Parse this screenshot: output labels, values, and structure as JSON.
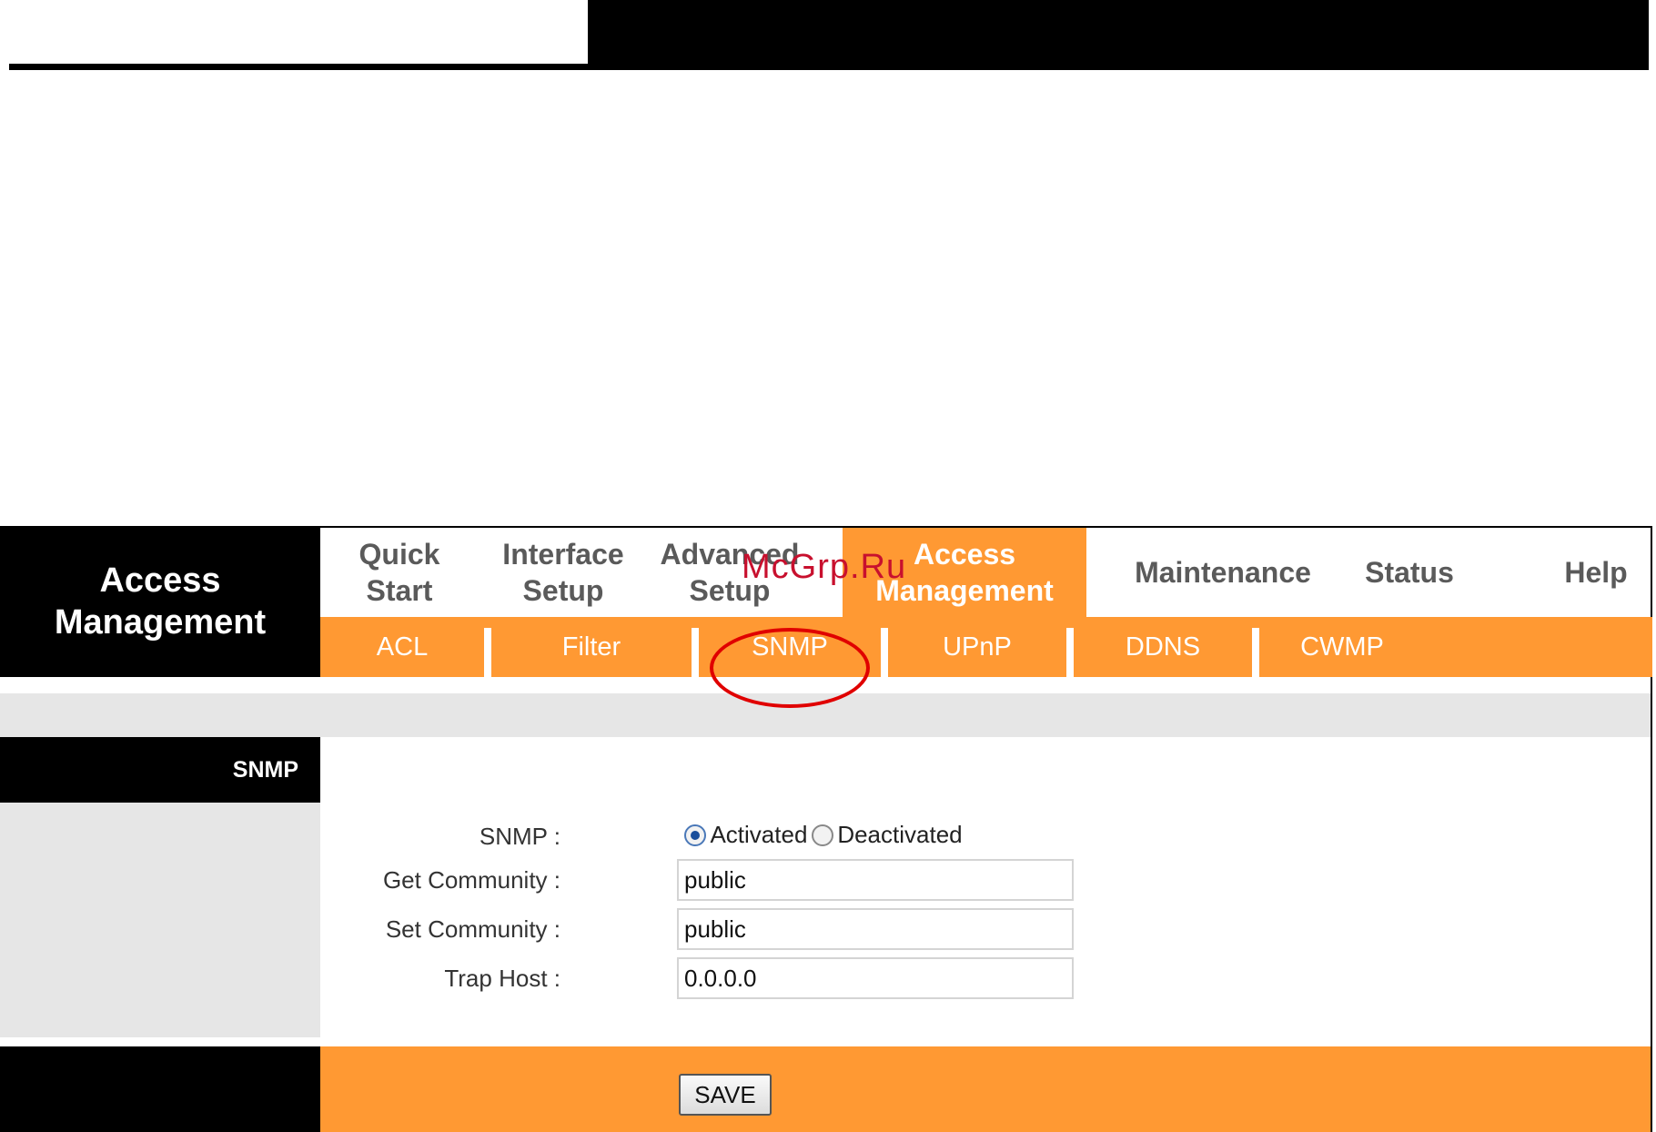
{
  "brand": {
    "line1": "Access",
    "line2": "Management"
  },
  "mainnav": [
    {
      "line1": "Quick",
      "line2": "Start"
    },
    {
      "line1": "Interface",
      "line2": "Setup"
    },
    {
      "line1": "Advanced",
      "line2": "Setup"
    },
    {
      "line1": "Access",
      "line2": "Management",
      "active": true
    },
    {
      "line1": "Maintenance",
      "line2": ""
    },
    {
      "line1": "Status",
      "line2": ""
    },
    {
      "line1": "Help",
      "line2": ""
    }
  ],
  "subnav": [
    "ACL",
    "Filter",
    "SNMP",
    "UPnP",
    "DDNS",
    "CWMP"
  ],
  "watermark": "McGrp.Ru",
  "section": {
    "title": "SNMP"
  },
  "form": {
    "snmp_label": "SNMP :",
    "activated_label": "Activated",
    "deactivated_label": "Deactivated",
    "selected": "Activated",
    "get_community_label": "Get Community :",
    "get_community_value": "public",
    "set_community_label": "Set Community :",
    "set_community_value": "public",
    "trap_host_label": "Trap Host :",
    "trap_host_value": "0.0.0.0"
  },
  "buttons": {
    "save": "SAVE"
  },
  "colors": {
    "accent": "#ff9933",
    "highlight_ring": "#e00000"
  }
}
